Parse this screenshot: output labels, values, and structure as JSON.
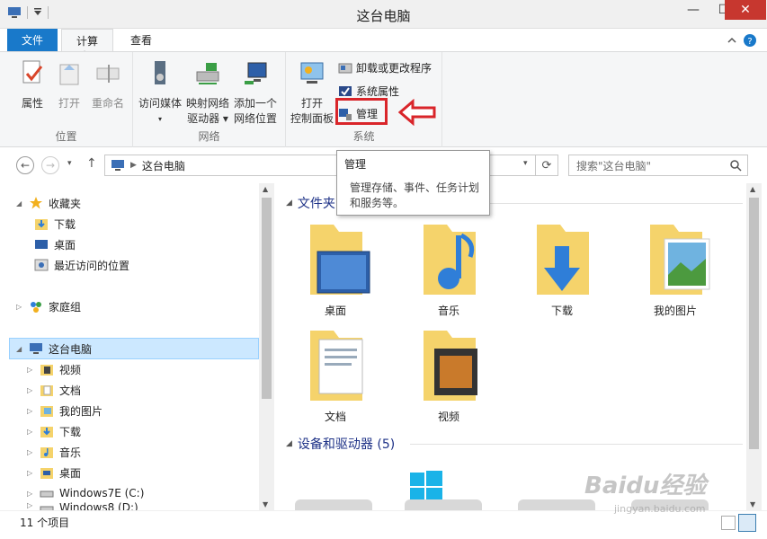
{
  "window": {
    "title": "这台电脑",
    "minimize": "—",
    "maximize": "☐",
    "close": "✕"
  },
  "tabs": {
    "file": "文件",
    "computer": "计算机",
    "view": "查看"
  },
  "ribbon": {
    "location": {
      "label": "位置",
      "properties": "属性",
      "open": "打开",
      "rename": "重命名"
    },
    "network": {
      "label": "网络",
      "media_l1": "访问媒体",
      "map_l1": "映射网络",
      "map_l2": "驱动器 ▾",
      "add_l1": "添加一个",
      "add_l2": "网络位置"
    },
    "system": {
      "label": "系统",
      "open_cp_l1": "打开",
      "open_cp_l2": "控制面板",
      "uninstall": "卸载或更改程序",
      "sys_props": "系统属性",
      "manage": "管理"
    }
  },
  "address": {
    "path": "这台电脑",
    "search_placeholder": "搜索\"这台电脑\""
  },
  "nav": {
    "favorites": "收藏夹",
    "downloads": "下载",
    "desktop": "桌面",
    "recent": "最近访问的位置",
    "homegroup": "家庭组",
    "thispc": "这台电脑",
    "videos": "视频",
    "documents": "文档",
    "pictures": "我的图片",
    "downloads2": "下载",
    "music": "音乐",
    "desktop2": "桌面",
    "drive_c": "Windows7E (C:)",
    "drive_d": "Windows8 (D:)"
  },
  "content": {
    "folders_title": "文件夹 (6)",
    "folders": [
      "桌面",
      "音乐",
      "下载",
      "我的图片",
      "文档",
      "视频"
    ],
    "devices_title": "设备和驱动器 (5)"
  },
  "tooltip": {
    "title": "管理",
    "line1": "管理存储、事件、任务计划",
    "line2": "和服务等。"
  },
  "status": {
    "count": "11 个项目"
  },
  "watermark": {
    "brand": "Baidu经验",
    "url": "jingyan.baidu.com"
  },
  "colors": {
    "accent": "#1979ca",
    "highlight": "#d9252a",
    "folder": "#f5d36b",
    "selection": "#cce8ff"
  }
}
